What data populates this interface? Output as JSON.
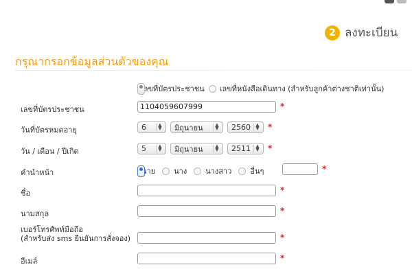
{
  "step": {
    "number": "2",
    "label": "ลงทะเบียน"
  },
  "section_title": "กรุณากรอกข้อมูลส่วนตัวของคุณ",
  "id_type": {
    "option_citizen": "เลขที่บัตรประชาชน",
    "option_passport": "เลขที่หนังสือเดินทาง (สำหรับลูกค้าต่างชาติเท่านั้น)"
  },
  "fields": {
    "id_number": {
      "label": "เลขที่บัตรประชาชน",
      "value": "1104059607999"
    },
    "expiry": {
      "label": "วันที่บัตรหมดอายุ",
      "day": "6",
      "month": "มิถุนายน",
      "year": "2560"
    },
    "birth": {
      "label": "วัน / เดือน / ปีเกิด",
      "day": "5",
      "month": "มิถุนายน",
      "year": "2511"
    },
    "title": {
      "label": "คำนำหน้า",
      "options": [
        "นาย",
        "นาง",
        "นางสาว",
        "อื่นๆ"
      ]
    },
    "first_name": {
      "label": "ชื่อ",
      "value": ""
    },
    "last_name": {
      "label": "นามสกุล",
      "value": ""
    },
    "phone": {
      "label_line1": "เบอร์โทรศัพท์มือถือ",
      "label_line2": "(สำหรับส่ง sms ยืนยันการสั่งจอง)",
      "value": ""
    },
    "email": {
      "label": "อีเมล์",
      "value": ""
    }
  },
  "required_mark": "*",
  "colors": {
    "accent": "#f39c12",
    "badge": "#f0b400",
    "required": "#e0202e"
  }
}
